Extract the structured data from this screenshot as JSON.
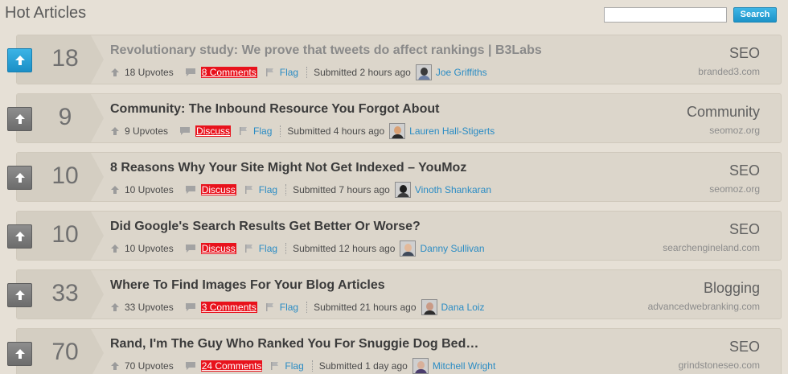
{
  "header": {
    "title": "Hot Articles",
    "search_placeholder": "",
    "search_button": "Search"
  },
  "colors": {
    "accent_blue": "#1c93c8",
    "comment_red": "#e8121c",
    "link_blue": "#2b8cc4"
  },
  "articles": [
    {
      "score": "18",
      "title": "Revolutionary study: We prove that tweets do affect rankings | B3Labs",
      "upvotes": "18 Upvotes",
      "comments": "8 Comments",
      "flag": "Flag",
      "submitted": "Submitted 2 hours ago",
      "user": "Joe Griffiths",
      "category": "SEO",
      "domain": "branded3.com",
      "upvoted": true,
      "visited": true
    },
    {
      "score": "9",
      "title": "Community: The Inbound Resource You Forgot About",
      "upvotes": "9 Upvotes",
      "comments": "Discuss",
      "flag": "Flag",
      "submitted": "Submitted 4 hours ago",
      "user": "Lauren Hall-Stigerts",
      "category": "Community",
      "domain": "seomoz.org",
      "upvoted": false,
      "visited": false
    },
    {
      "score": "10",
      "title": "8 Reasons Why Your Site Might Not Get Indexed – YouMoz",
      "upvotes": "10 Upvotes",
      "comments": "Discuss",
      "flag": "Flag",
      "submitted": "Submitted 7 hours ago",
      "user": "Vinoth Shankaran",
      "category": "SEO",
      "domain": "seomoz.org",
      "upvoted": false,
      "visited": false
    },
    {
      "score": "10",
      "title": "Did Google's Search Results Get Better Or Worse?",
      "upvotes": "10 Upvotes",
      "comments": "Discuss",
      "flag": "Flag",
      "submitted": "Submitted 12 hours ago",
      "user": "Danny Sullivan",
      "category": "SEO",
      "domain": "searchengineland.com",
      "upvoted": false,
      "visited": false
    },
    {
      "score": "33",
      "title": "Where To Find Images For Your Blog Articles",
      "upvotes": "33 Upvotes",
      "comments": "3 Comments",
      "flag": "Flag",
      "submitted": "Submitted 21 hours ago",
      "user": "Dana Loiz",
      "category": "Blogging",
      "domain": "advancedwebranking.com",
      "upvoted": false,
      "visited": false
    },
    {
      "score": "70",
      "title": "Rand, I'm The Guy Who Ranked You For Snuggie Dog Bed…",
      "upvotes": "70 Upvotes",
      "comments": "24 Comments",
      "flag": "Flag",
      "submitted": "Submitted 1 day ago",
      "user": "Mitchell Wright",
      "category": "SEO",
      "domain": "grindstoneseo.com",
      "upvoted": false,
      "visited": false
    }
  ]
}
